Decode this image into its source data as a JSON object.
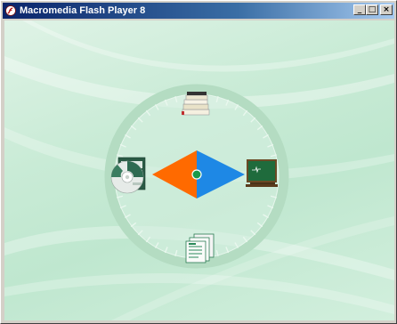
{
  "window": {
    "title": "Macromedia Flash Player 8",
    "buttons": {
      "minimize": "_",
      "maximize": "□",
      "close": "×"
    }
  },
  "colors": {
    "title_start": "#0a246a",
    "title_end": "#a6caf0",
    "stage_bg": "#c9ebd6",
    "left_diamond": "#ff6a00",
    "right_diamond": "#1e88e5",
    "center_dot": "#1a9a4a",
    "dial_ring": "#b4dcc2"
  },
  "dial": {
    "icons": {
      "top": "books-icon",
      "right": "chalkboard-icon",
      "bottom": "documents-icon",
      "left": "cd-icon"
    }
  }
}
